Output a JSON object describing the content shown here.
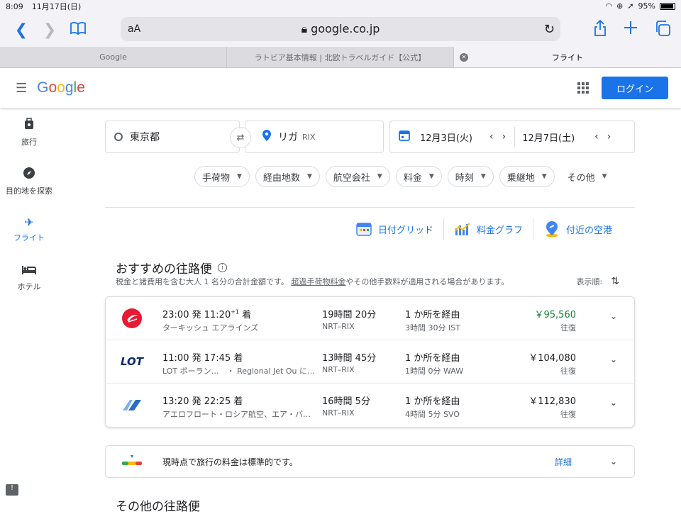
{
  "status": {
    "time": "8:09",
    "date": "11月17日(日)",
    "battery": "95%",
    "battery_level": 0.95
  },
  "browser": {
    "text_size": "aA",
    "url": "google.co.jp",
    "tabs": [
      {
        "label": "Google"
      },
      {
        "label": "ラトビア基本情報 | 北欧トラベルガイド【公式】"
      },
      {
        "label": "フライト"
      }
    ]
  },
  "header": {
    "logo": "Google",
    "login_label": "ログイン"
  },
  "sidebar": [
    {
      "label": "旅行",
      "icon": "travel-icon"
    },
    {
      "label": "目的地を探索",
      "icon": "explore-icon"
    },
    {
      "label": "フライト",
      "icon": "flight-icon"
    },
    {
      "label": "ホテル",
      "icon": "hotel-icon"
    }
  ],
  "search": {
    "origin": "東京都",
    "destination": "リガ",
    "destination_code": "RIX",
    "depart_date": "12月3日(火)",
    "return_date": "12月7日(土)"
  },
  "filters": [
    "手荷物",
    "経由地数",
    "航空会社",
    "料金",
    "時刻",
    "乗継地",
    "その他"
  ],
  "tools": [
    "日付グリッド",
    "料金グラフ",
    "付近の空港"
  ],
  "section": {
    "title": "おすすめの往路便",
    "subtitle_before": "税金と諸費用を含む大人 1 名分の合計金額です。",
    "subtitle_link": "超過手荷物料金",
    "subtitle_after": "やその他手数料が適用される場合があります。",
    "sort_label": "表示順:"
  },
  "flights": [
    {
      "depart": "23:00 発",
      "arrive": "11:20",
      "arrive_plus": "+1",
      "arrive_suffix": "着",
      "airline": "ターキッシュ エアラインズ",
      "duration": "19時間 20分",
      "route": "NRT–RIX",
      "stops": "1 か所を経由",
      "layover": "3時間 30分 IST",
      "price": "￥95,560",
      "price_note": "往復",
      "cheapest": true
    },
    {
      "depart": "11:00 発",
      "arrive": "17:45",
      "arrive_plus": "",
      "arrive_suffix": "着",
      "airline": "LOT ポーラン…　・ Regional Jet Ou に…",
      "duration": "13時間 45分",
      "route": "NRT–RIX",
      "stops": "1 か所を経由",
      "layover": "1時間 0分 WAW",
      "price": "￥104,080",
      "price_note": "往復",
      "cheapest": false
    },
    {
      "depart": "13:20 発",
      "arrive": "22:25",
      "arrive_plus": "",
      "arrive_suffix": "着",
      "airline": "アエロフロート・ロシア航空、エア・バ…",
      "duration": "16時間 5分",
      "route": "NRT–RIX",
      "stops": "1 か所を経由",
      "layover": "4時間 5分 SVO",
      "price": "￥112,830",
      "price_note": "往復",
      "cheapest": false
    }
  ],
  "tip": {
    "message": "現時点で旅行の料金は標準的です。",
    "details_label": "詳細"
  },
  "other_title": "その他の往路便",
  "colors": {
    "accent": "#1a73e8",
    "cheap_price": "#188038"
  }
}
